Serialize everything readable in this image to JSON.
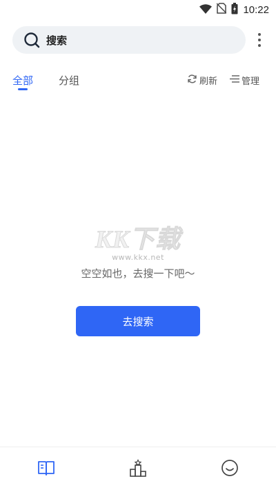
{
  "status_bar": {
    "time": "10:22",
    "icons": [
      "wifi-icon",
      "no-sim-icon",
      "battery-charging-icon"
    ]
  },
  "search": {
    "label": "搜索",
    "icon": "search-icon"
  },
  "header": {
    "more_icon": "more-vertical-icon"
  },
  "tabs": [
    {
      "label": "全部",
      "active": true
    },
    {
      "label": "分组",
      "active": false
    }
  ],
  "actions": {
    "refresh_label": "刷新",
    "refresh_icon": "refresh-icon",
    "manage_label": "管理",
    "manage_icon": "list-icon"
  },
  "empty_state": {
    "watermark_logo": "KK下载",
    "watermark_url": "www.kkx.net",
    "message": "空空如也，去搜一下吧～",
    "button_label": "去搜索"
  },
  "bottom_nav": [
    {
      "icon": "book-icon",
      "active": true
    },
    {
      "icon": "ranking-icon",
      "active": false
    },
    {
      "icon": "smile-icon",
      "active": false
    }
  ],
  "colors": {
    "accent": "#2f66f5",
    "search_bg": "#eff2f5",
    "text_secondary": "#555555"
  }
}
